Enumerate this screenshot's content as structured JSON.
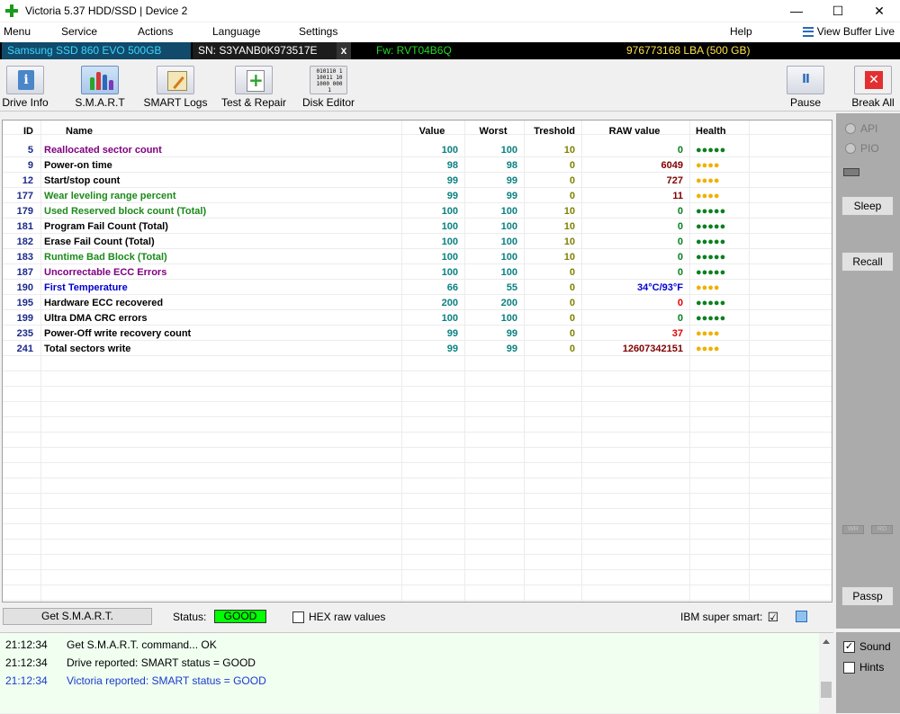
{
  "window": {
    "title": "Victoria 5.37 HDD/SSD | Device 2",
    "minimize": "—",
    "maximize": "☐",
    "close": "✕"
  },
  "menu": {
    "items": [
      "Menu",
      "Service",
      "Actions",
      "Language",
      "Settings",
      "Help"
    ],
    "view_buffer": "View Buffer Live"
  },
  "device": {
    "model": "Samsung SSD 860 EVO 500GB",
    "sn": "SN: S3YANB0K973517E",
    "x": "x",
    "fw": "Fw: RVT04B6Q",
    "lba": "976773168 LBA (500 GB)"
  },
  "toolbar": {
    "drive_info": "Drive Info",
    "smart": "S.M.A.R.T",
    "smart_logs": "SMART Logs",
    "test_repair": "Test & Repair",
    "disk_editor": "Disk Editor",
    "pause": "Pause",
    "break_all": "Break All"
  },
  "table": {
    "headers": {
      "id": "ID",
      "name": "Name",
      "value": "Value",
      "worst": "Worst",
      "treshold": "Treshold",
      "raw": "RAW value",
      "health": "Health"
    },
    "rows": [
      {
        "id": "5",
        "name": "Reallocated sector count",
        "name_color": "#800080",
        "value": "100",
        "worst": "100",
        "tresh": "10",
        "tresh_color": "#808000",
        "raw": "0",
        "raw_color": "#0a8020",
        "health": "●●●●●",
        "health_color": "#0a8020"
      },
      {
        "id": "9",
        "name": "Power-on time",
        "name_color": "#000000",
        "value": "98",
        "worst": "98",
        "tresh": "0",
        "tresh_color": "#808000",
        "raw": "6049",
        "raw_color": "#800000",
        "health": "●●●●",
        "health_color": "#f0b000"
      },
      {
        "id": "12",
        "name": "Start/stop count",
        "name_color": "#000000",
        "value": "99",
        "worst": "99",
        "tresh": "0",
        "tresh_color": "#808000",
        "raw": "727",
        "raw_color": "#800000",
        "health": "●●●●",
        "health_color": "#f0b000"
      },
      {
        "id": "177",
        "name": "Wear leveling range percent",
        "name_color": "#1a8a1a",
        "value": "99",
        "worst": "99",
        "tresh": "0",
        "tresh_color": "#808000",
        "raw": "11",
        "raw_color": "#800000",
        "health": "●●●●",
        "health_color": "#f0b000"
      },
      {
        "id": "179",
        "name": "Used Reserved block count (Total)",
        "name_color": "#1a8a1a",
        "value": "100",
        "worst": "100",
        "tresh": "10",
        "tresh_color": "#808000",
        "raw": "0",
        "raw_color": "#0a8020",
        "health": "●●●●●",
        "health_color": "#0a8020"
      },
      {
        "id": "181",
        "name": "Program Fail Count (Total)",
        "name_color": "#000000",
        "value": "100",
        "worst": "100",
        "tresh": "10",
        "tresh_color": "#808000",
        "raw": "0",
        "raw_color": "#0a8020",
        "health": "●●●●●",
        "health_color": "#0a8020"
      },
      {
        "id": "182",
        "name": "Erase Fail Count (Total)",
        "name_color": "#000000",
        "value": "100",
        "worst": "100",
        "tresh": "10",
        "tresh_color": "#808000",
        "raw": "0",
        "raw_color": "#0a8020",
        "health": "●●●●●",
        "health_color": "#0a8020"
      },
      {
        "id": "183",
        "name": "Runtime Bad Block (Total)",
        "name_color": "#1a8a1a",
        "value": "100",
        "worst": "100",
        "tresh": "10",
        "tresh_color": "#808000",
        "raw": "0",
        "raw_color": "#0a8020",
        "health": "●●●●●",
        "health_color": "#0a8020"
      },
      {
        "id": "187",
        "name": "Uncorrectable ECC Errors",
        "name_color": "#800080",
        "value": "100",
        "worst": "100",
        "tresh": "0",
        "tresh_color": "#808000",
        "raw": "0",
        "raw_color": "#0a8020",
        "health": "●●●●●",
        "health_color": "#0a8020"
      },
      {
        "id": "190",
        "name": "First Temperature",
        "name_color": "#0000d0",
        "value": "66",
        "worst": "55",
        "tresh": "0",
        "tresh_color": "#808000",
        "raw": "34°C/93°F",
        "raw_color": "#0000d0",
        "health": "●●●●",
        "health_color": "#f0b000"
      },
      {
        "id": "195",
        "name": "Hardware ECC recovered",
        "name_color": "#000000",
        "value": "200",
        "worst": "200",
        "tresh": "0",
        "tresh_color": "#808000",
        "raw": "0",
        "raw_color": "#e00000",
        "health": "●●●●●",
        "health_color": "#0a8020"
      },
      {
        "id": "199",
        "name": "Ultra DMA CRC errors",
        "name_color": "#000000",
        "value": "100",
        "worst": "100",
        "tresh": "0",
        "tresh_color": "#808000",
        "raw": "0",
        "raw_color": "#0a8020",
        "health": "●●●●●",
        "health_color": "#0a8020"
      },
      {
        "id": "235",
        "name": "Power-Off write recovery count",
        "name_color": "#000000",
        "value": "99",
        "worst": "99",
        "tresh": "0",
        "tresh_color": "#808000",
        "raw": "37",
        "raw_color": "#e00000",
        "health": "●●●●",
        "health_color": "#f0b000"
      },
      {
        "id": "241",
        "name": "Total sectors write",
        "name_color": "#000000",
        "value": "99",
        "worst": "99",
        "tresh": "0",
        "tresh_color": "#808000",
        "raw": "12607342151",
        "raw_color": "#800000",
        "health": "●●●●",
        "health_color": "#f0b000"
      }
    ]
  },
  "right_panel": {
    "api": "API",
    "pio": "PIO",
    "sleep": "Sleep",
    "recall": "Recall",
    "wr": "WR",
    "rd": "RD",
    "passp": "Passp"
  },
  "statusbar": {
    "get_smart": "Get S.M.A.R.T.",
    "status_label": "Status:",
    "status_value": "GOOD",
    "hex_raw": "HEX raw values",
    "ibm_super_smart": "IBM super smart:",
    "ibm_checked": "☑"
  },
  "log": [
    {
      "time": "21:12:34",
      "text": "Get S.M.A.R.T. command... OK",
      "color": "#000000"
    },
    {
      "time": "21:12:34",
      "text": "Drive reported: SMART status = GOOD",
      "color": "#000000"
    },
    {
      "time": "21:12:34",
      "text": "Victoria reported: SMART status = GOOD",
      "color": "#1a3ad0"
    }
  ],
  "side_options": {
    "sound": "Sound",
    "sound_checked": "✓",
    "hints": "Hints"
  }
}
